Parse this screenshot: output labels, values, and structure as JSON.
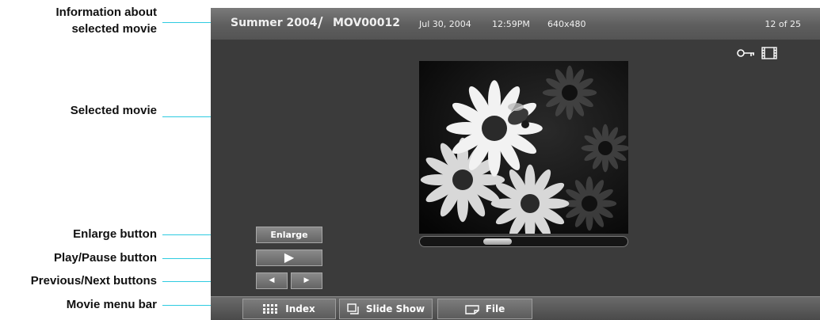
{
  "callouts": {
    "info_line1": "Information about",
    "info_line2": "selected movie",
    "selected_movie": "Selected movie",
    "enlarge_button": "Enlarge button",
    "play_pause_button": "Play/Pause button",
    "prev_next_buttons": "Previous/Next buttons",
    "movie_menu_bar": "Movie menu bar"
  },
  "header": {
    "album": "Summer 2004",
    "separator": "/",
    "movie_name": "MOV00012",
    "date": "Jul 30, 2004",
    "time": "12:59PM",
    "resolution": "640x480",
    "position": "12 of 25"
  },
  "status_icons": [
    "key-icon",
    "film-icon"
  ],
  "player": {
    "thumbnail": "flower-bee-thumbnail",
    "progress": 0.35
  },
  "controls": {
    "enlarge_label": "Enlarge",
    "play_symbol": "▶",
    "prev_symbol": "◀",
    "next_symbol": "▶"
  },
  "menubar": {
    "index_label": "Index",
    "slideshow_label": "Slide Show",
    "file_label": "File"
  },
  "colors": {
    "leader_line": "#2ecbe0",
    "screen_bg": "#3b3b3b"
  }
}
